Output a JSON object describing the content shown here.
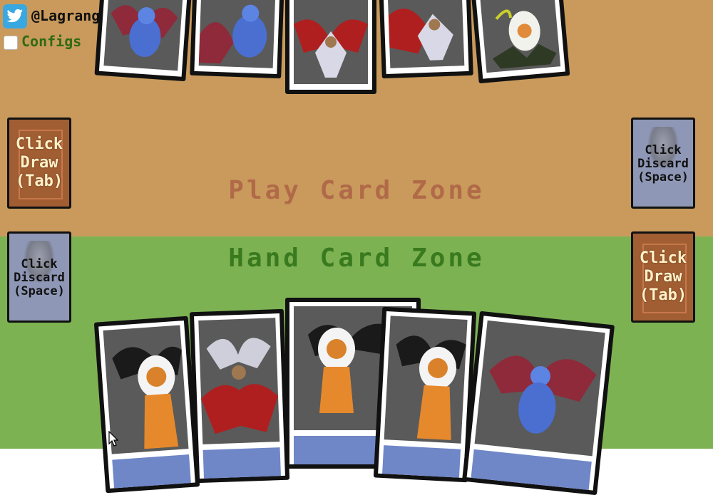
{
  "header": {
    "twitter_handle": "@LagrangeSpot",
    "configs_label": "Configs"
  },
  "zones": {
    "play_title": "Play Card Zone",
    "hand_title": "Hand Card Zone"
  },
  "piles": {
    "player": {
      "draw_label": "Click\nDraw\n(Tab)",
      "discard_label": "Click\nDiscard\n(Space)"
    },
    "opponent": {
      "draw_label": "Click\nDraw\n(Tab)",
      "discard_label": "Click\nDiscard\n(Space)"
    }
  },
  "play_cards": [
    {
      "creature": "blue-winged-demon"
    },
    {
      "creature": "blue-winged-demon"
    },
    {
      "creature": "red-dragon"
    },
    {
      "creature": "red-dragon"
    },
    {
      "creature": "serpent-egg"
    }
  ],
  "hand_cards": [
    {
      "creature": "winged-lion"
    },
    {
      "creature": "red-dragon"
    },
    {
      "creature": "winged-lion"
    },
    {
      "creature": "winged-lion"
    },
    {
      "creature": "blue-winged-demon"
    }
  ],
  "colors": {
    "play_zone": "#c99a5c",
    "hand_zone": "#7db253",
    "draw_pile": "#a15e33",
    "discard_pile": "#8e97b5",
    "card_foot": "#6f86c7"
  }
}
